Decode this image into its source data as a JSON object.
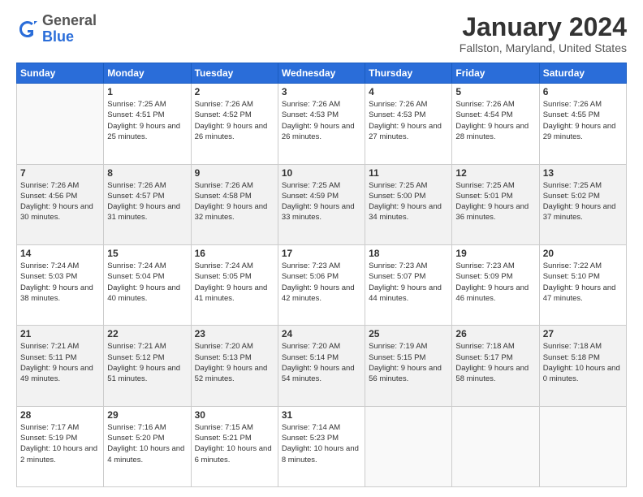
{
  "header": {
    "logo_general": "General",
    "logo_blue": "Blue",
    "main_title": "January 2024",
    "subtitle": "Fallston, Maryland, United States"
  },
  "calendar": {
    "days_of_week": [
      "Sunday",
      "Monday",
      "Tuesday",
      "Wednesday",
      "Thursday",
      "Friday",
      "Saturday"
    ],
    "weeks": [
      [
        {
          "day": "",
          "empty": true
        },
        {
          "day": "1",
          "sunrise": "7:25 AM",
          "sunset": "4:51 PM",
          "daylight": "9 hours and 25 minutes."
        },
        {
          "day": "2",
          "sunrise": "7:26 AM",
          "sunset": "4:52 PM",
          "daylight": "9 hours and 26 minutes."
        },
        {
          "day": "3",
          "sunrise": "7:26 AM",
          "sunset": "4:53 PM",
          "daylight": "9 hours and 26 minutes."
        },
        {
          "day": "4",
          "sunrise": "7:26 AM",
          "sunset": "4:53 PM",
          "daylight": "9 hours and 27 minutes."
        },
        {
          "day": "5",
          "sunrise": "7:26 AM",
          "sunset": "4:54 PM",
          "daylight": "9 hours and 28 minutes."
        },
        {
          "day": "6",
          "sunrise": "7:26 AM",
          "sunset": "4:55 PM",
          "daylight": "9 hours and 29 minutes."
        }
      ],
      [
        {
          "day": "7",
          "sunrise": "7:26 AM",
          "sunset": "4:56 PM",
          "daylight": "9 hours and 30 minutes."
        },
        {
          "day": "8",
          "sunrise": "7:26 AM",
          "sunset": "4:57 PM",
          "daylight": "9 hours and 31 minutes."
        },
        {
          "day": "9",
          "sunrise": "7:26 AM",
          "sunset": "4:58 PM",
          "daylight": "9 hours and 32 minutes."
        },
        {
          "day": "10",
          "sunrise": "7:25 AM",
          "sunset": "4:59 PM",
          "daylight": "9 hours and 33 minutes."
        },
        {
          "day": "11",
          "sunrise": "7:25 AM",
          "sunset": "5:00 PM",
          "daylight": "9 hours and 34 minutes."
        },
        {
          "day": "12",
          "sunrise": "7:25 AM",
          "sunset": "5:01 PM",
          "daylight": "9 hours and 36 minutes."
        },
        {
          "day": "13",
          "sunrise": "7:25 AM",
          "sunset": "5:02 PM",
          "daylight": "9 hours and 37 minutes."
        }
      ],
      [
        {
          "day": "14",
          "sunrise": "7:24 AM",
          "sunset": "5:03 PM",
          "daylight": "9 hours and 38 minutes."
        },
        {
          "day": "15",
          "sunrise": "7:24 AM",
          "sunset": "5:04 PM",
          "daylight": "9 hours and 40 minutes."
        },
        {
          "day": "16",
          "sunrise": "7:24 AM",
          "sunset": "5:05 PM",
          "daylight": "9 hours and 41 minutes."
        },
        {
          "day": "17",
          "sunrise": "7:23 AM",
          "sunset": "5:06 PM",
          "daylight": "9 hours and 42 minutes."
        },
        {
          "day": "18",
          "sunrise": "7:23 AM",
          "sunset": "5:07 PM",
          "daylight": "9 hours and 44 minutes."
        },
        {
          "day": "19",
          "sunrise": "7:23 AM",
          "sunset": "5:09 PM",
          "daylight": "9 hours and 46 minutes."
        },
        {
          "day": "20",
          "sunrise": "7:22 AM",
          "sunset": "5:10 PM",
          "daylight": "9 hours and 47 minutes."
        }
      ],
      [
        {
          "day": "21",
          "sunrise": "7:21 AM",
          "sunset": "5:11 PM",
          "daylight": "9 hours and 49 minutes."
        },
        {
          "day": "22",
          "sunrise": "7:21 AM",
          "sunset": "5:12 PM",
          "daylight": "9 hours and 51 minutes."
        },
        {
          "day": "23",
          "sunrise": "7:20 AM",
          "sunset": "5:13 PM",
          "daylight": "9 hours and 52 minutes."
        },
        {
          "day": "24",
          "sunrise": "7:20 AM",
          "sunset": "5:14 PM",
          "daylight": "9 hours and 54 minutes."
        },
        {
          "day": "25",
          "sunrise": "7:19 AM",
          "sunset": "5:15 PM",
          "daylight": "9 hours and 56 minutes."
        },
        {
          "day": "26",
          "sunrise": "7:18 AM",
          "sunset": "5:17 PM",
          "daylight": "9 hours and 58 minutes."
        },
        {
          "day": "27",
          "sunrise": "7:18 AM",
          "sunset": "5:18 PM",
          "daylight": "10 hours and 0 minutes."
        }
      ],
      [
        {
          "day": "28",
          "sunrise": "7:17 AM",
          "sunset": "5:19 PM",
          "daylight": "10 hours and 2 minutes."
        },
        {
          "day": "29",
          "sunrise": "7:16 AM",
          "sunset": "5:20 PM",
          "daylight": "10 hours and 4 minutes."
        },
        {
          "day": "30",
          "sunrise": "7:15 AM",
          "sunset": "5:21 PM",
          "daylight": "10 hours and 6 minutes."
        },
        {
          "day": "31",
          "sunrise": "7:14 AM",
          "sunset": "5:23 PM",
          "daylight": "10 hours and 8 minutes."
        },
        {
          "day": "",
          "empty": true
        },
        {
          "day": "",
          "empty": true
        },
        {
          "day": "",
          "empty": true
        }
      ]
    ]
  }
}
